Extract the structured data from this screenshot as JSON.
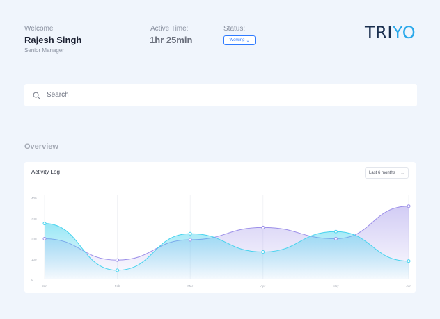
{
  "header": {
    "welcome_label": "Welcome",
    "user_name": "Rajesh Singh",
    "user_role": "Senior Manager",
    "active_label": "Active Time:",
    "active_value": "1hr 25min",
    "status_label": "Status:",
    "status_value": "Working",
    "logo_part1": "TRI",
    "logo_part2": "YO"
  },
  "search": {
    "placeholder": "Search"
  },
  "overview": {
    "title": "Overview"
  },
  "activity_card": {
    "title": "Activity Log",
    "range_value": "Last 6 months"
  },
  "colors": {
    "accent": "#2f7bff",
    "cyan_series": "#46d3ee",
    "purple_series": "#9b8ee8",
    "background": "#f0f5fc"
  },
  "chart_data": {
    "type": "area",
    "title": "Activity Log",
    "categories": [
      "Jan",
      "Feb",
      "Mar",
      "Apr",
      "May",
      "Jun"
    ],
    "y_ticks": [
      "400",
      "300",
      "200",
      "100",
      "0"
    ],
    "ylim": [
      0,
      400
    ],
    "grid": true,
    "series": [
      {
        "color": "#46d3ee",
        "values": [
          275,
          45,
          225,
          135,
          235,
          90
        ]
      },
      {
        "color": "#9b8ee8",
        "values": [
          200,
          95,
          195,
          255,
          200,
          360
        ]
      }
    ]
  }
}
